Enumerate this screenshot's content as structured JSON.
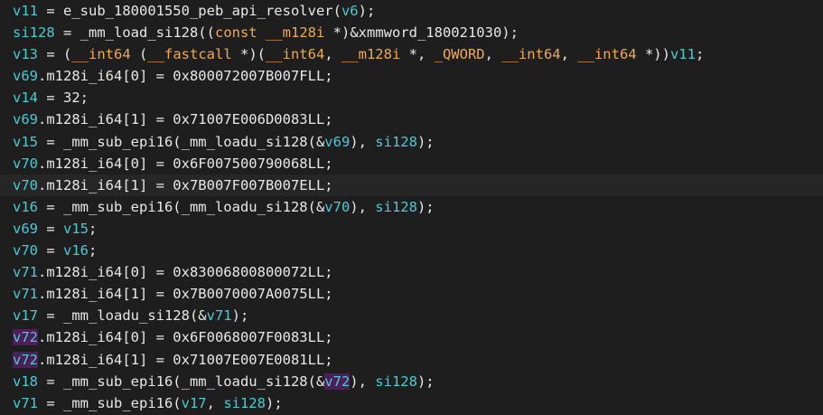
{
  "colors": {
    "background": "#1e1e1e",
    "current_line": "#262626",
    "variable": "#4ec9d6",
    "keyword": "#f0a85a",
    "text": "#e8e8e8",
    "highlight": "#4b1f58"
  },
  "lines": [
    {
      "tokens": [
        {
          "t": "v11",
          "c": "var"
        },
        {
          "t": " = e_sub_180001550_peb_api_resolver(",
          "c": "ident"
        },
        {
          "t": "v6",
          "c": "var"
        },
        {
          "t": ");",
          "c": "ident"
        }
      ]
    },
    {
      "tokens": [
        {
          "t": "si128",
          "c": "var"
        },
        {
          "t": " = _mm_load_si128((",
          "c": "ident"
        },
        {
          "t": "const",
          "c": "kw"
        },
        {
          "t": " ",
          "c": "ident"
        },
        {
          "t": "__m128i",
          "c": "kw"
        },
        {
          "t": " *)&xmmword_180021030);",
          "c": "ident"
        }
      ]
    },
    {
      "tokens": [
        {
          "t": "v13",
          "c": "var"
        },
        {
          "t": " = (",
          "c": "ident"
        },
        {
          "t": "__int64",
          "c": "kw"
        },
        {
          "t": " (",
          "c": "ident"
        },
        {
          "t": "__fastcall",
          "c": "kw"
        },
        {
          "t": " *)(",
          "c": "ident"
        },
        {
          "t": "__int64",
          "c": "kw"
        },
        {
          "t": ", ",
          "c": "ident"
        },
        {
          "t": "__m128i",
          "c": "kw"
        },
        {
          "t": " *, ",
          "c": "ident"
        },
        {
          "t": "_QWORD",
          "c": "kw"
        },
        {
          "t": ", ",
          "c": "ident"
        },
        {
          "t": "__int64",
          "c": "kw"
        },
        {
          "t": ", ",
          "c": "ident"
        },
        {
          "t": "__int64",
          "c": "kw"
        },
        {
          "t": " *))",
          "c": "ident"
        },
        {
          "t": "v11",
          "c": "var"
        },
        {
          "t": ";",
          "c": "ident"
        }
      ]
    },
    {
      "tokens": [
        {
          "t": "v69",
          "c": "var"
        },
        {
          "t": ".m128i_i64[0] = 0x800072007B007FLL;",
          "c": "ident"
        }
      ]
    },
    {
      "tokens": [
        {
          "t": "v14",
          "c": "var"
        },
        {
          "t": " = 32;",
          "c": "ident"
        }
      ]
    },
    {
      "tokens": [
        {
          "t": "v69",
          "c": "var"
        },
        {
          "t": ".m128i_i64[1] = 0x71007E006D0083LL;",
          "c": "ident"
        }
      ]
    },
    {
      "tokens": [
        {
          "t": "v15",
          "c": "var"
        },
        {
          "t": " = _mm_sub_epi16(_mm_loadu_si128(&",
          "c": "ident"
        },
        {
          "t": "v69",
          "c": "var"
        },
        {
          "t": "), ",
          "c": "ident"
        },
        {
          "t": "si128",
          "c": "var"
        },
        {
          "t": ");",
          "c": "ident"
        }
      ]
    },
    {
      "tokens": [
        {
          "t": "v70",
          "c": "var"
        },
        {
          "t": ".m128i_i64[0] = 0x6F007500790068LL;",
          "c": "ident"
        }
      ]
    },
    {
      "tokens": [
        {
          "t": "v70",
          "c": "var"
        },
        {
          "t": ".m128i_i64[1] = 0x7B007F007B007ELL;",
          "c": "ident"
        }
      ],
      "current": true
    },
    {
      "tokens": [
        {
          "t": "v16",
          "c": "var"
        },
        {
          "t": " = _mm_sub_epi16(_mm_loadu_si128(&",
          "c": "ident"
        },
        {
          "t": "v70",
          "c": "var"
        },
        {
          "t": "), ",
          "c": "ident"
        },
        {
          "t": "si128",
          "c": "var"
        },
        {
          "t": ");",
          "c": "ident"
        }
      ]
    },
    {
      "tokens": [
        {
          "t": "v69",
          "c": "var"
        },
        {
          "t": " = ",
          "c": "ident"
        },
        {
          "t": "v15",
          "c": "var"
        },
        {
          "t": ";",
          "c": "ident"
        }
      ]
    },
    {
      "tokens": [
        {
          "t": "v70",
          "c": "var"
        },
        {
          "t": " = ",
          "c": "ident"
        },
        {
          "t": "v16",
          "c": "var"
        },
        {
          "t": ";",
          "c": "ident"
        }
      ]
    },
    {
      "tokens": [
        {
          "t": "v71",
          "c": "var"
        },
        {
          "t": ".m128i_i64[0] = 0x83006800800072LL;",
          "c": "ident"
        }
      ]
    },
    {
      "tokens": [
        {
          "t": "v71",
          "c": "var"
        },
        {
          "t": ".m128i_i64[1] = 0x7B0070007A0075LL;",
          "c": "ident"
        }
      ]
    },
    {
      "tokens": [
        {
          "t": "v17",
          "c": "var"
        },
        {
          "t": " = _mm_loadu_si128(&",
          "c": "ident"
        },
        {
          "t": "v71",
          "c": "var"
        },
        {
          "t": ");",
          "c": "ident"
        }
      ]
    },
    {
      "tokens": [
        {
          "t": "v72",
          "c": "hl"
        },
        {
          "t": ".m128i_i64[0] = 0x6F0068007F0083LL;",
          "c": "ident"
        }
      ]
    },
    {
      "tokens": [
        {
          "t": "v72",
          "c": "hl"
        },
        {
          "t": ".m128i_i64[1] = 0x71007E007E0081LL;",
          "c": "ident"
        }
      ]
    },
    {
      "tokens": [
        {
          "t": "v18",
          "c": "var"
        },
        {
          "t": " = _mm_sub_epi16(_mm_loadu_si128(&",
          "c": "ident"
        },
        {
          "t": "v72",
          "c": "hl"
        },
        {
          "t": "), ",
          "c": "ident"
        },
        {
          "t": "si128",
          "c": "var"
        },
        {
          "t": ");",
          "c": "ident"
        }
      ]
    },
    {
      "tokens": [
        {
          "t": "v71",
          "c": "var"
        },
        {
          "t": " = _mm_sub_epi16(",
          "c": "ident"
        },
        {
          "t": "v17",
          "c": "var"
        },
        {
          "t": ", ",
          "c": "ident"
        },
        {
          "t": "si128",
          "c": "var"
        },
        {
          "t": ");",
          "c": "ident"
        }
      ]
    }
  ]
}
